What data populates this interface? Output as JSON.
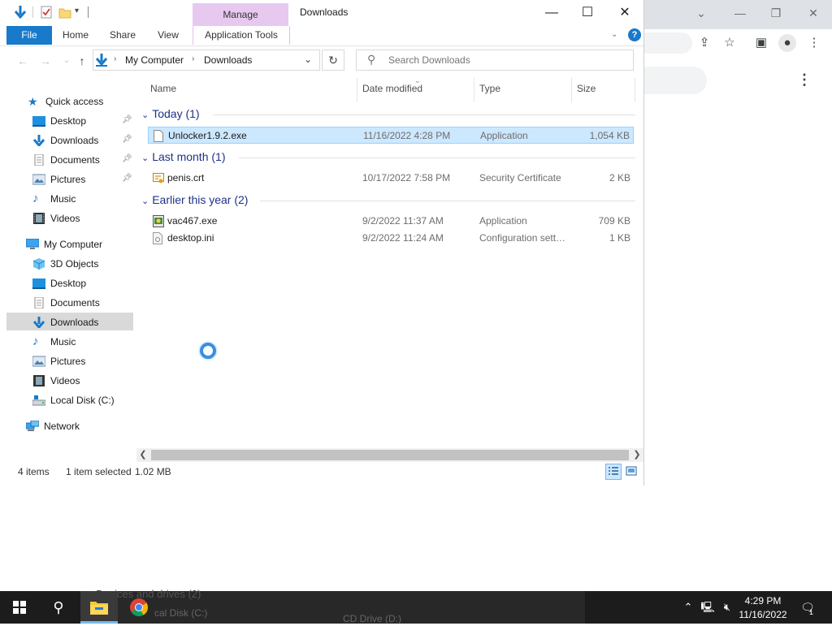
{
  "explorer": {
    "window_title": "Downloads",
    "manage_label": "Manage",
    "app_tools_label": "Application Tools",
    "ribbon_tabs": {
      "file": "File",
      "home": "Home",
      "share": "Share",
      "view": "View"
    },
    "breadcrumb": [
      "My Computer",
      "Downloads"
    ],
    "search_placeholder": "Search Downloads",
    "columns": {
      "name": "Name",
      "date": "Date modified",
      "type": "Type",
      "size": "Size"
    },
    "groups": [
      {
        "label": "Today (1)",
        "files": [
          {
            "name": "Unlocker1.9.2.exe",
            "date": "11/16/2022 4:28 PM",
            "type": "Application",
            "size": "1,054 KB",
            "selected": true
          }
        ]
      },
      {
        "label": "Last month (1)",
        "files": [
          {
            "name": "penis.crt",
            "date": "10/17/2022 7:58 PM",
            "type": "Security Certificate",
            "size": "2 KB"
          }
        ]
      },
      {
        "label": "Earlier this year (2)",
        "files": [
          {
            "name": "vac467.exe",
            "date": "9/2/2022 11:37 AM",
            "type": "Application",
            "size": "709 KB"
          },
          {
            "name": "desktop.ini",
            "date": "9/2/2022 11:24 AM",
            "type": "Configuration sett…",
            "size": "1 KB"
          }
        ]
      }
    ],
    "nav": {
      "quick_access": "Quick access",
      "quick_items": [
        "Desktop",
        "Downloads",
        "Documents",
        "Pictures",
        "Music",
        "Videos"
      ],
      "my_computer": "My Computer",
      "pc_items": [
        "3D Objects",
        "Desktop",
        "Documents",
        "Downloads",
        "Music",
        "Pictures",
        "Videos",
        "Local Disk (C:)"
      ],
      "network": "Network"
    },
    "status": {
      "items": "4 items",
      "selected": "1 item selected",
      "size": "1.02 MB"
    }
  },
  "taskbar": {
    "time": "4:29 PM",
    "date": "11/16/2022",
    "notifications": "1",
    "ghost_1": "Devices and drives (2)",
    "ghost_2": "cal Disk (C:)",
    "ghost_3": "CD Drive (D:)"
  },
  "colors": {
    "accent": "#1979ca",
    "manage": "#e7c9f0",
    "selection": "#cce8ff",
    "group": "#1e3287"
  }
}
